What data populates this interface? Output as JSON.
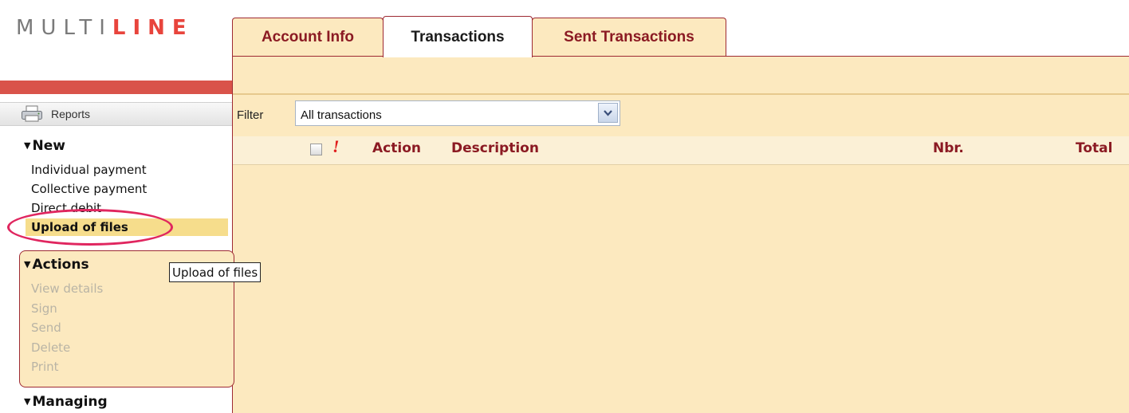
{
  "logo": {
    "part1": "MULTI",
    "part2": "LINE"
  },
  "tabs": [
    {
      "label": "Account Info"
    },
    {
      "label": "Transactions",
      "active": true
    },
    {
      "label": "Sent Transactions"
    }
  ],
  "filter": {
    "label": "Filter",
    "value": "All transactions"
  },
  "table": {
    "columns": [
      "",
      "!",
      "Action",
      "Description",
      "Nbr.",
      "Total"
    ]
  },
  "sidebar": {
    "reports_label": "Reports",
    "new": {
      "title": "New",
      "items": [
        "Individual payment",
        "Collective payment",
        "Direct debit",
        "Upload of files"
      ]
    },
    "actions": {
      "title": "Actions",
      "items": [
        "View details",
        "Sign",
        "Send",
        "Delete",
        "Print"
      ]
    },
    "managing": {
      "title": "Managing"
    }
  },
  "tooltip": {
    "text": "Upload of files"
  },
  "colors": {
    "accent": "#8b1a23",
    "panel": "#fce9bf",
    "highlight": "#f6dd8c",
    "annotation_circle": "#e0265f"
  }
}
